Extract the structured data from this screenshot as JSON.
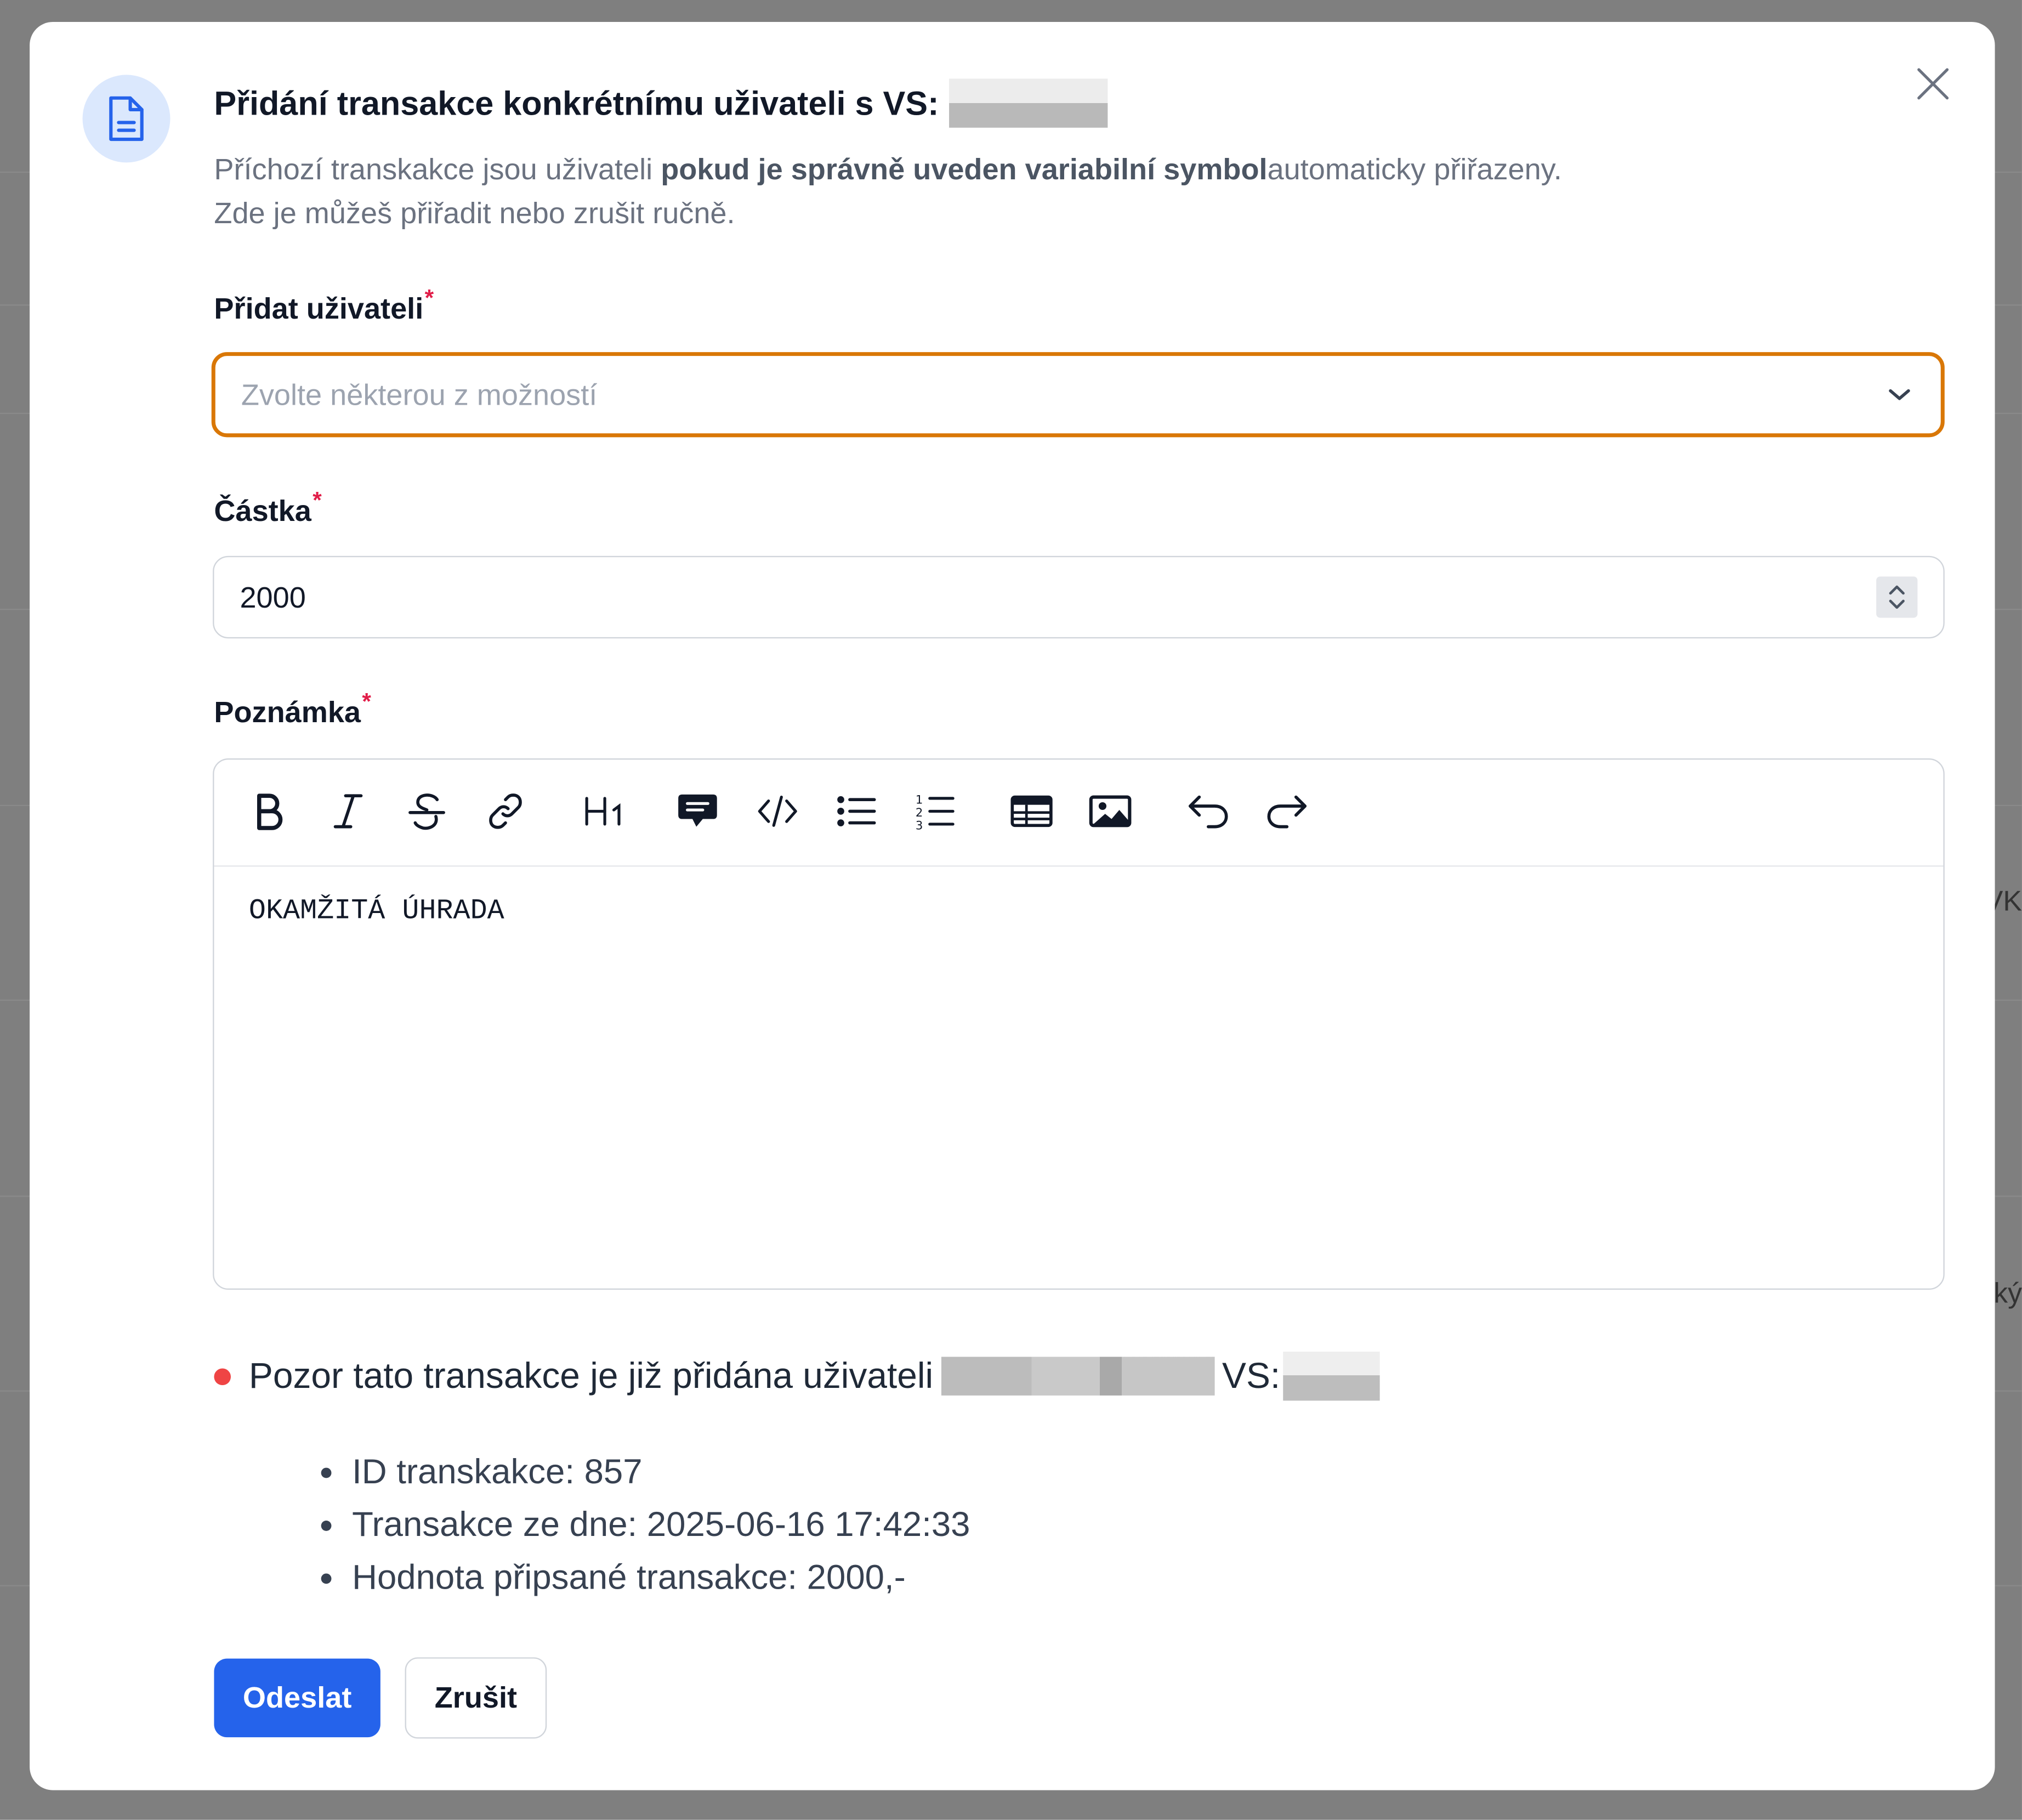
{
  "dialog": {
    "title": "Přidání transakce konkrétnímu uživateli s VS:",
    "description": {
      "part1": "Příchozí transkakce jsou uživateli ",
      "bold": "pokud je správně uveden variabilní symbol",
      "part2": "automaticky přiřazeny.",
      "line2": "Zde je můžeš přiřadit nebo zrušit ručně."
    }
  },
  "fields": {
    "user": {
      "label": "Přidat uživateli",
      "required_mark": "*",
      "placeholder": "Zvolte některou z možností"
    },
    "amount": {
      "label": "Částka",
      "required_mark": "*",
      "value": "2000"
    },
    "note": {
      "label": "Poznámka",
      "required_mark": "*",
      "content": "OKAMŽITÁ ÚHRADA"
    }
  },
  "toolbar_icons": [
    "bold-icon",
    "italic-icon",
    "strikethrough-icon",
    "link-icon",
    "heading-icon",
    "quote-icon",
    "code-icon",
    "bullet-list-icon",
    "numbered-list-icon",
    "table-icon",
    "image-icon",
    "undo-icon",
    "redo-icon"
  ],
  "warning": {
    "text": "Pozor tato transakce je již přidána uživateli",
    "vs_label": "VS:",
    "details": [
      "ID transkakce: 857",
      "Transakce ze dne: 2025-06-16 17:42:33",
      "Hodnota připsané transakce: 2000,-"
    ]
  },
  "buttons": {
    "submit": "Odeslat",
    "cancel": "Zrušit"
  },
  "background": {
    "text1": "VK",
    "text2": "ký"
  },
  "colors": {
    "accent": "#2563eb",
    "focus_border": "#d97706",
    "warning_dot": "#ef4444",
    "icon_bg": "#dbe8fd"
  }
}
